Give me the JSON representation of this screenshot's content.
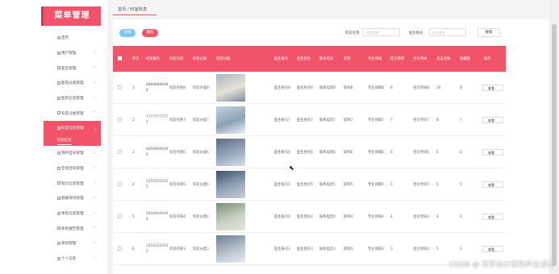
{
  "brand": {
    "logo": "菜单管理"
  },
  "sidebar": {
    "items": [
      {
        "label": "首页",
        "icon": "home-icon"
      },
      {
        "label": "用户管理",
        "icon": "grid-icon"
      },
      {
        "label": "医生管理",
        "icon": "grid-icon"
      },
      {
        "label": "医院分类管理",
        "icon": "grid-icon"
      },
      {
        "label": "医院信息管理",
        "icon": "grid-icon"
      },
      {
        "label": "科室分类管理",
        "icon": "grid-icon"
      },
      {
        "label": "科室信息管理",
        "icon": "grid-icon",
        "active": true
      },
      {
        "label": "预约挂号管理",
        "icon": "user-icon"
      },
      {
        "label": "在线咨询管理",
        "icon": "grid-icon"
      },
      {
        "label": "就诊信息管理",
        "icon": "grid-icon"
      },
      {
        "label": "健康资讯管理",
        "icon": "grid-icon"
      },
      {
        "label": "体检信息管理",
        "icon": "gear-icon"
      },
      {
        "label": "体检报告管理",
        "icon": "grid-icon"
      },
      {
        "label": "系统管理",
        "icon": "gear-icon"
      },
      {
        "label": "个人信息",
        "icon": "person-icon"
      }
    ],
    "submenu": {
      "label": "科室信息"
    }
  },
  "breadcrumb": {
    "text": "首页 / 科室信息"
  },
  "toolbar": {
    "add_label": "新增",
    "delete_label": "删除",
    "filter1_label": "科室名称",
    "filter1_placeholder": "科室名称",
    "filter2_label": "医生姓名",
    "filter2_placeholder": "医生姓名",
    "search_label": "搜索"
  },
  "table": {
    "headers": [
      "序号",
      "科室编号",
      "科室名称",
      "科室分类",
      "科室封面",
      "医生账号",
      "医生姓名",
      "联系电话",
      "职称",
      "专业领域",
      "挂号费用",
      "坐诊时间",
      "点击次数",
      "收藏数",
      "操作"
    ],
    "rows": [
      {
        "idx": "1",
        "code": "88888888888",
        "name": "科室名称8",
        "cat": "科室分类8",
        "acct": "医生账号8",
        "doc": "医生姓名8",
        "tel": "联系电话8",
        "title": "职称8",
        "field": "专业领域8",
        "fee": "8",
        "time": "坐诊时间8",
        "clicks": "10",
        "fav": "8",
        "action": "查看"
      },
      {
        "idx": "2",
        "code": "77777777777",
        "name": "科室名称7",
        "cat": "科室分类7",
        "acct": "医生账号7",
        "doc": "医生姓名7",
        "tel": "联系电话7",
        "title": "职称7",
        "field": "专业领域7",
        "fee": "7",
        "time": "坐诊时间7",
        "clicks": "8",
        "fav": "7",
        "action": "查看"
      },
      {
        "idx": "3",
        "code": "66666666666",
        "name": "科室名称6",
        "cat": "科室分类6",
        "acct": "医生账号6",
        "doc": "医生姓名6",
        "tel": "联系电话6",
        "title": "职称6",
        "field": "专业领域6",
        "fee": "6",
        "time": "坐诊时间6",
        "clicks": "6",
        "fav": "6",
        "action": "查看"
      },
      {
        "idx": "4",
        "code": "55555555555",
        "name": "科室名称5",
        "cat": "科室分类5",
        "acct": "医生账号5",
        "doc": "医生姓名5",
        "tel": "联系电话5",
        "title": "职称5",
        "field": "专业领域5",
        "fee": "5",
        "time": "坐诊时间5",
        "clicks": "5",
        "fav": "5",
        "action": "查看"
      },
      {
        "idx": "5",
        "code": "44444444444",
        "name": "科室名称4",
        "cat": "科室分类4",
        "acct": "医生账号4",
        "doc": "医生姓名4",
        "tel": "联系电话4",
        "title": "职称4",
        "field": "专业领域4",
        "fee": "4",
        "time": "坐诊时间4",
        "clicks": "4",
        "fav": "4",
        "action": "查看"
      },
      {
        "idx": "6",
        "code": "33333333333",
        "name": "科室名称3",
        "cat": "科室分类3",
        "acct": "医生账号3",
        "doc": "医生姓名3",
        "tel": "联系电话3",
        "title": "职称3",
        "field": "专业领域3",
        "fee": "3",
        "time": "坐诊时间3",
        "clicks": "5",
        "fav": "3",
        "action": "查看"
      }
    ]
  },
  "watermark": "CSDN @ 花学长计算机毕业设计",
  "colors": {
    "accent": "#f0536a",
    "add_button": "#7cc4f6"
  }
}
